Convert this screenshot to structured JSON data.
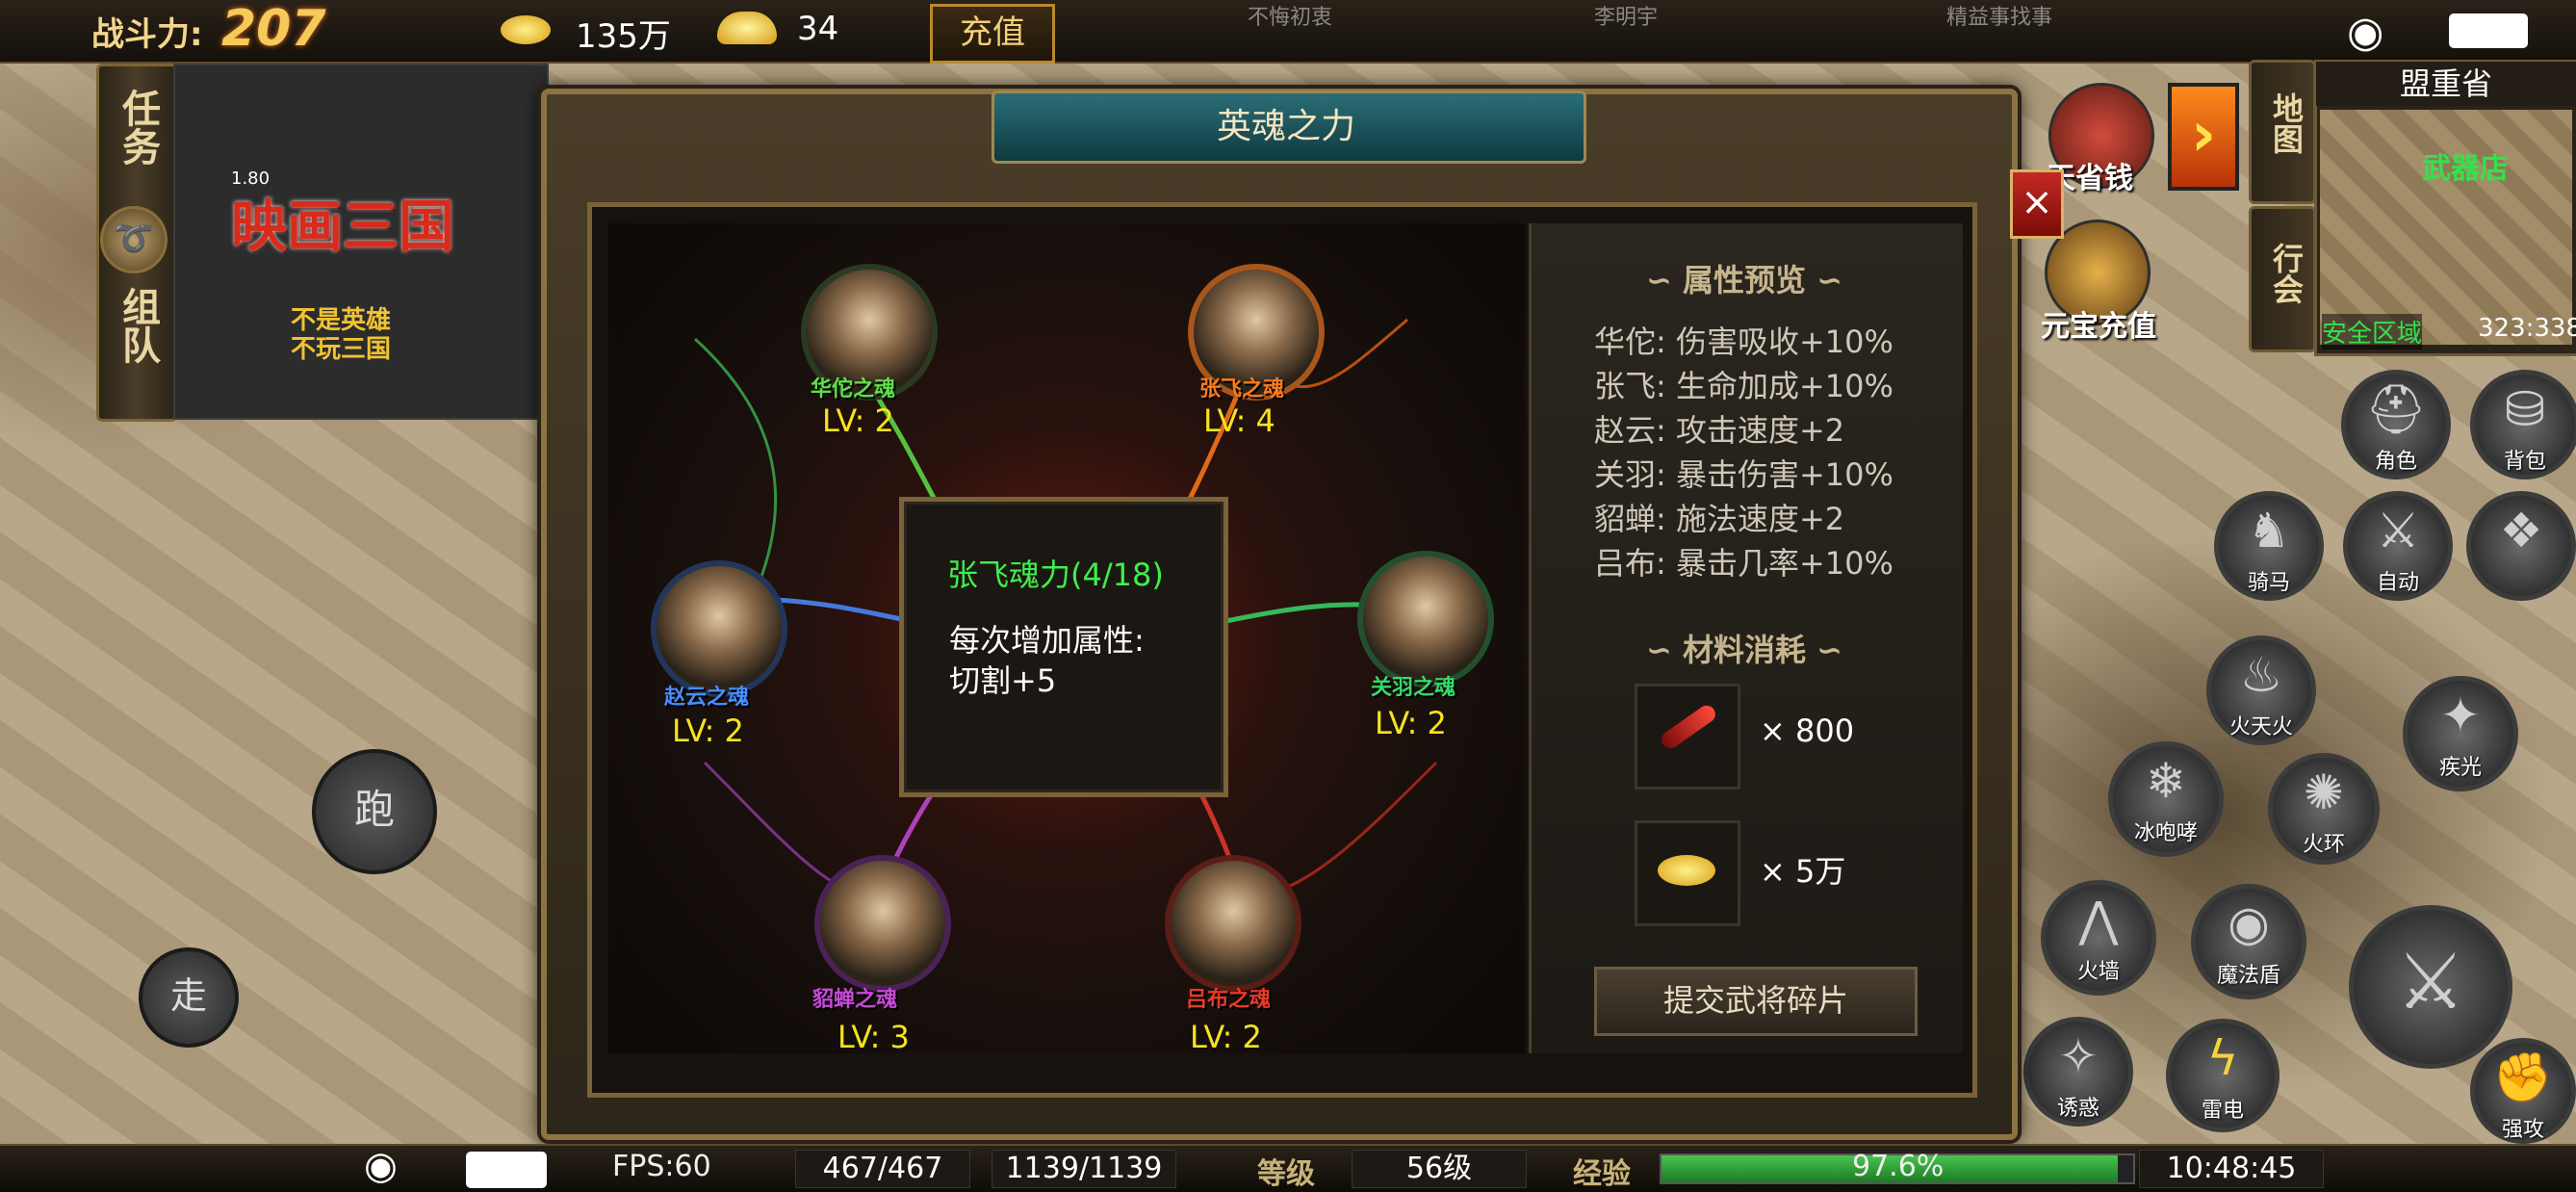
{
  "top": {
    "power_label": "战斗力:",
    "power_value": "207",
    "gold": "135万",
    "ingots": "34",
    "recharge": "充值",
    "bg_names": [
      "不悔初衷",
      "李明宇",
      "精益事找事"
    ]
  },
  "left_panel": {
    "task_tab": "任务",
    "team_tab": "组队",
    "ad_title": "映画三国",
    "ad_version": "1.80",
    "ad_slogan": "不是英雄 不玩三国"
  },
  "controls": {
    "run": "跑",
    "walk": "走"
  },
  "minimap": {
    "region": "盟重省",
    "map_button": "地图",
    "guild_button": "行会",
    "poi_label": "武器店",
    "safe_zone": "安全区域",
    "coords": "323:338"
  },
  "events": {
    "save_money": "天省钱",
    "topup": "元宝充值"
  },
  "skills": {
    "character": "角色",
    "bag": "背包",
    "ride": "骑马",
    "auto": "自动",
    "fire_skill": "火天火",
    "light": "疾光",
    "ice_roar": "冰咆哮",
    "fire_ring": "火环",
    "fire_wall": "火墙",
    "magic_shield": "魔法盾",
    "lure": "诱惑",
    "thunder": "雷电",
    "strong_attack": "强攻"
  },
  "dialog": {
    "title": "英魂之力",
    "close": "×",
    "souls": [
      {
        "name": "华佗之魂",
        "level": "LV: 2",
        "color": "#5ee04a"
      },
      {
        "name": "张飞之魂",
        "level": "LV: 4",
        "color": "#ff7a1c"
      },
      {
        "name": "赵云之魂",
        "level": "LV: 2",
        "color": "#4a8cff"
      },
      {
        "name": "关羽之魂",
        "level": "LV: 2",
        "color": "#37d86a"
      },
      {
        "name": "貂蝉之魂",
        "level": "LV: 3",
        "color": "#c74ad8"
      },
      {
        "name": "吕布之魂",
        "level": "LV: 2",
        "color": "#e83a2a"
      }
    ],
    "tooltip": {
      "title": "张飞魂力(4/18)",
      "desc": "每次增加属性:",
      "effect": "切割+5"
    },
    "attr_heading": "∽ 属性预览 ∽",
    "attributes": [
      "华佗: 伤害吸收+10%",
      "张飞: 生命加成+10%",
      "赵云: 攻击速度+2",
      "关羽: 暴击伤害+10%",
      "貂蝉: 施法速度+2",
      "吕布: 暴击几率+10%"
    ],
    "materials_heading": "∽ 材料消耗 ∽",
    "materials": [
      {
        "qty": "×  800"
      },
      {
        "qty": "×  5万"
      }
    ],
    "submit": "提交武将碎片"
  },
  "bottom": {
    "fps": "FPS:60",
    "hp": "467/467",
    "mp": "1139/1139",
    "level_label": "等级",
    "level": "56级",
    "xp_label": "经验",
    "xp_percent": "97.6%",
    "xp_fraction": 0.976,
    "time": "10:48:45"
  }
}
